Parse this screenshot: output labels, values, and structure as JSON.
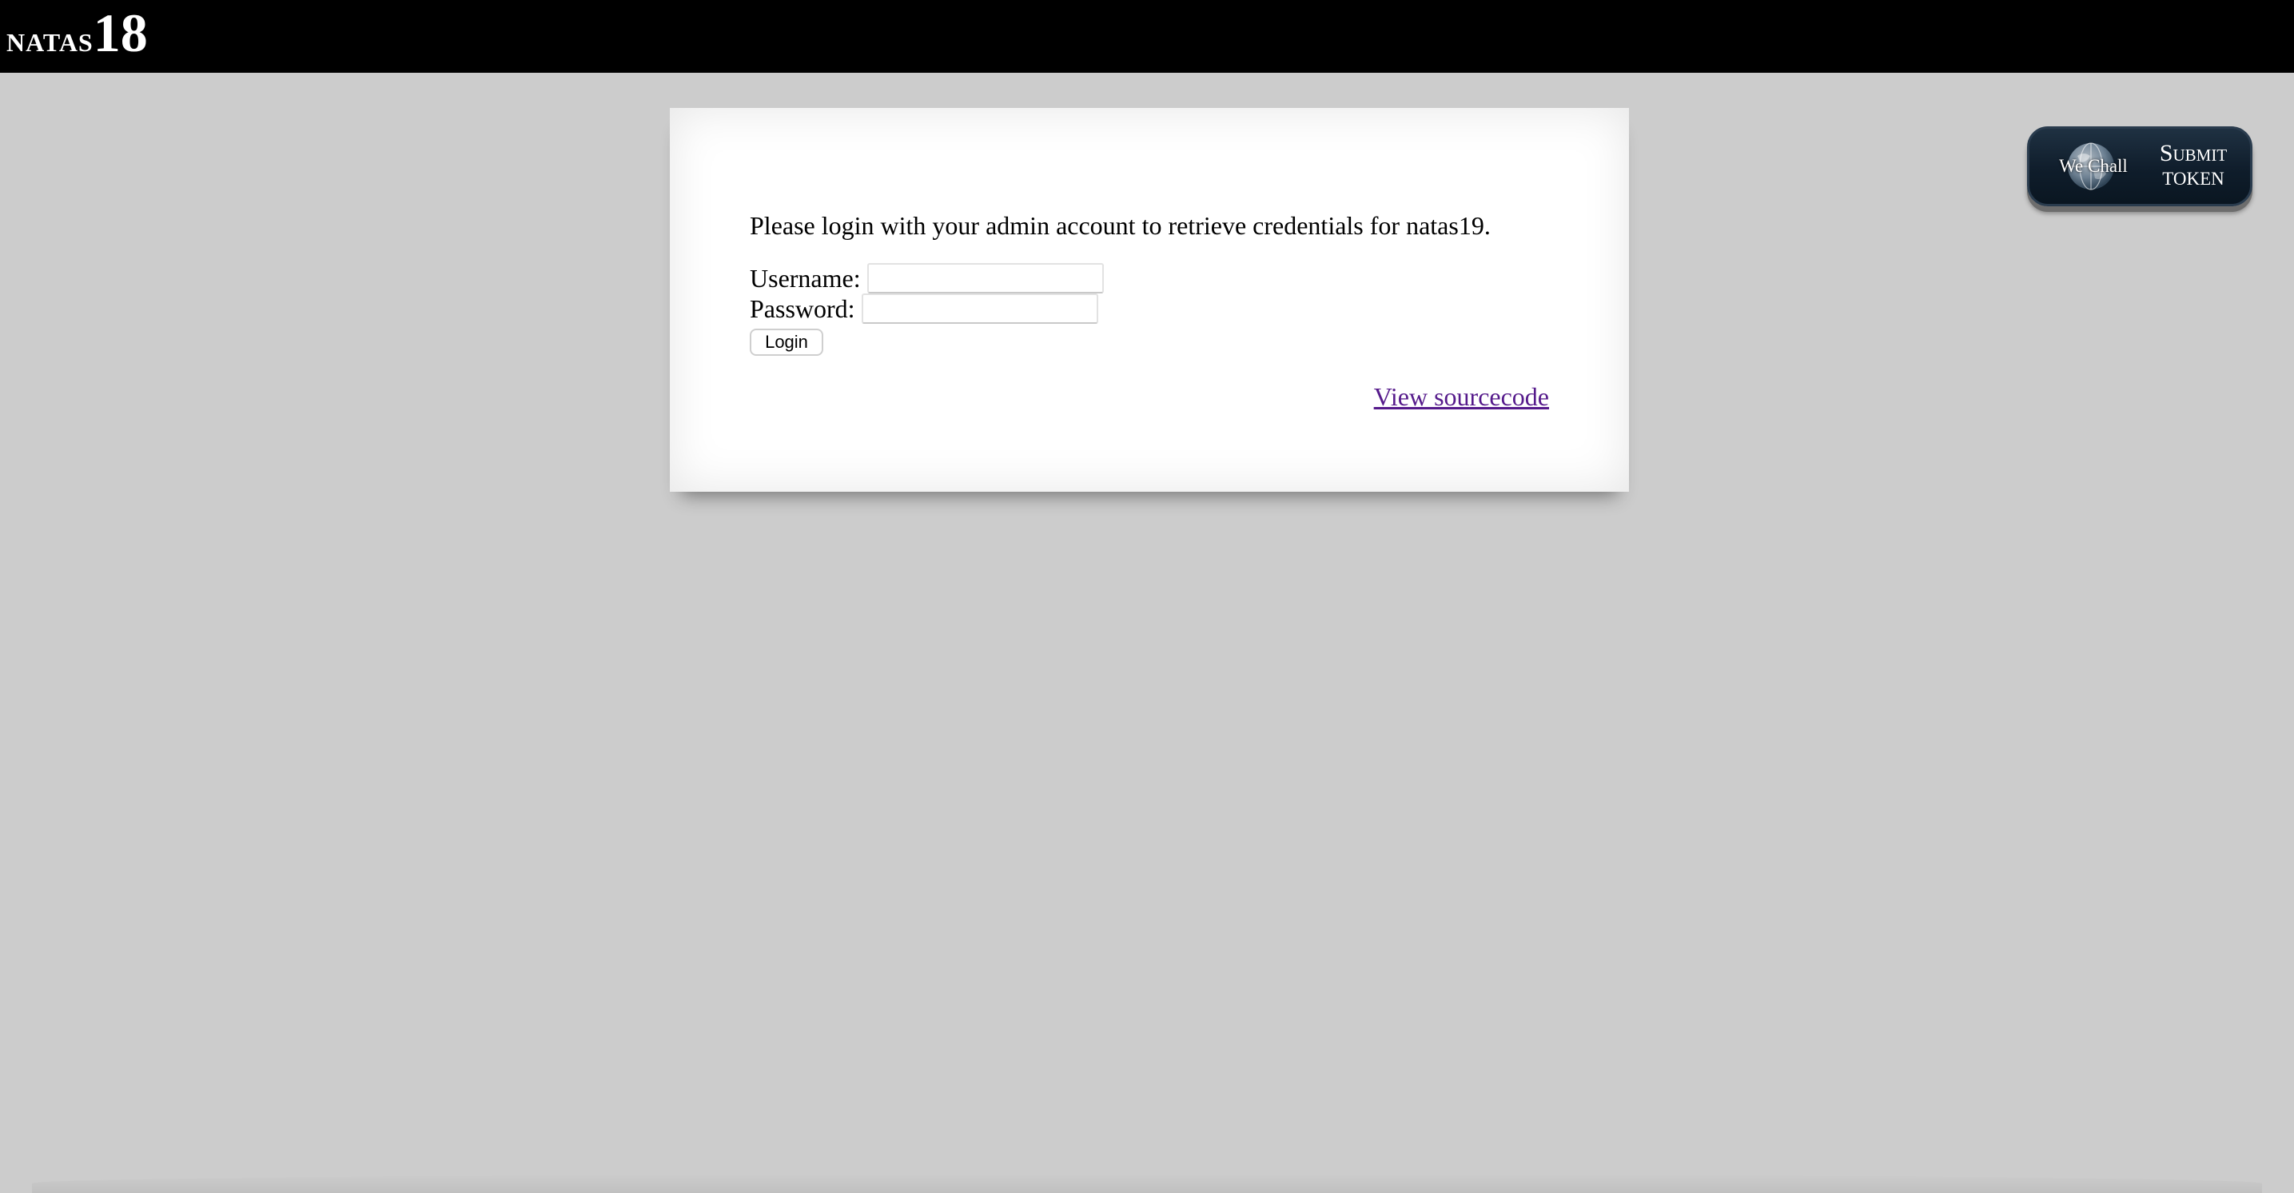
{
  "header": {
    "logo_text": "natas",
    "logo_number": "18"
  },
  "content": {
    "intro": "Please login with your admin account to retrieve credentials for natas19.",
    "form": {
      "username_label": "Username:",
      "username_value": "",
      "password_label": "Password:",
      "password_value": "",
      "login_label": "Login"
    },
    "source_link": "View sourcecode"
  },
  "wechall": {
    "name": "We Chall",
    "submit": "Submit",
    "token": "TOKEN",
    "globe_icon": "globe-icon"
  },
  "colors": {
    "header_bg": "#000000",
    "page_bg": "#cccccc",
    "link": "#551a8b"
  }
}
